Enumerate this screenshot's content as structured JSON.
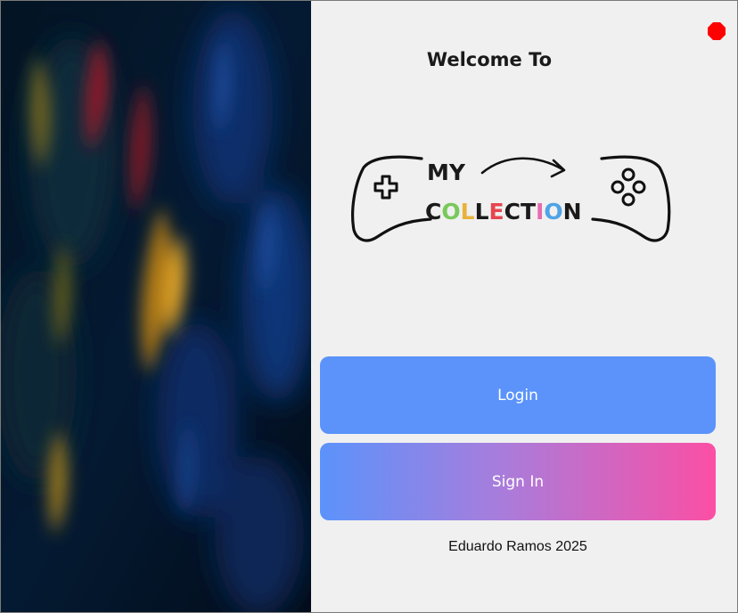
{
  "header": {
    "welcome_text": "Welcome To"
  },
  "logo": {
    "line1": "MY",
    "line2_letters": [
      "C",
      "O",
      "L",
      "L",
      "E",
      "C",
      "T",
      "I",
      "O",
      "N"
    ],
    "line2_colors": [
      "#1a1a1a",
      "#79c95a",
      "#e8b33c",
      "#1a1a1a",
      "#e64650",
      "#1a1a1a",
      "#1a1a1a",
      "#e86ab0",
      "#4fa3e6",
      "#1a1a1a"
    ]
  },
  "actions": {
    "login_label": "Login",
    "signin_label": "Sign In"
  },
  "footer": {
    "credit": "Eduardo Ramos 2025"
  },
  "colors": {
    "close_button": "#ff0000",
    "login_button": "#5b93fb",
    "signin_gradient_start": "#5b93fb",
    "signin_gradient_end": "#fb4fa5",
    "background": "#f0f0f0"
  },
  "icons": {
    "close": "close-icon",
    "controller": "gamepad-icon",
    "arrow": "curved-arrow-icon"
  }
}
